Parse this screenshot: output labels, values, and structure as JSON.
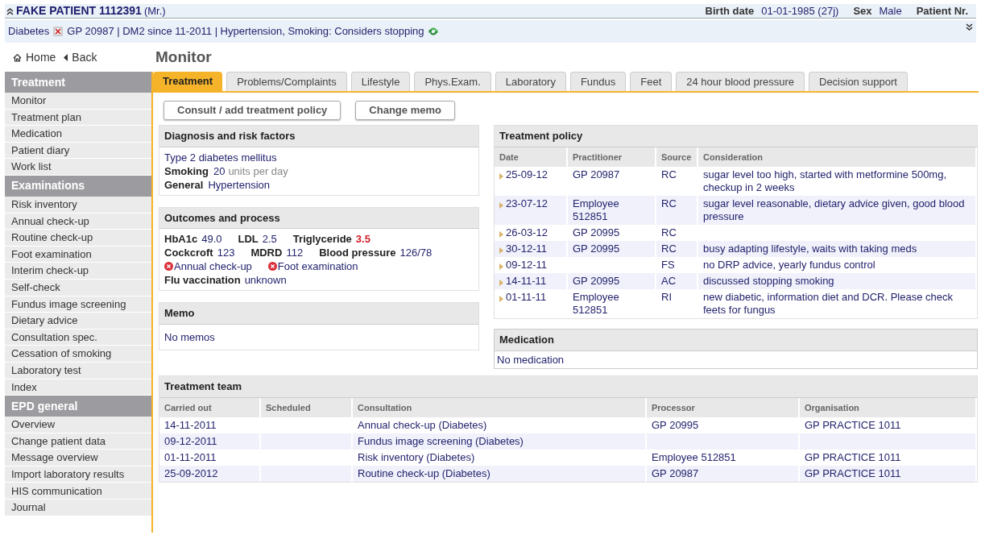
{
  "patient": {
    "name": "FAKE PATIENT 1112391",
    "title": "(Mr.)",
    "fields": [
      {
        "label": "Birth date",
        "value": "01-01-1985 (27j)"
      },
      {
        "label": "Sex",
        "value": "Male"
      },
      {
        "label": "Patient Nr."
      }
    ]
  },
  "problem_line": {
    "condition": "Diabetes",
    "summary": "GP 20987 | DM2 since 11-2011 | Hypertension, Smoking: Considers stopping"
  },
  "nav": {
    "home": "Home",
    "back": "Back"
  },
  "page_title": "Monitor",
  "sidebar": [
    {
      "title": "Treatment",
      "items": [
        "Monitor",
        "Treatment plan",
        "Medication",
        "Patient diary",
        "Work list"
      ]
    },
    {
      "title": "Examinations",
      "items": [
        "Risk inventory",
        "Annual check-up",
        "Routine check-up",
        "Foot examination",
        "Interim check-up",
        "Self-check",
        "Fundus image screening",
        "Dietary advice",
        "Consultation spec.",
        "Cessation of smoking",
        "Laboratory test",
        "Index"
      ]
    },
    {
      "title": "EPD general",
      "items": [
        "Overview",
        "Change patient data",
        "Message overview",
        "Import laboratory results",
        "HIS communication",
        "Journal"
      ]
    }
  ],
  "tabs": [
    {
      "label": "Treatment",
      "selected": true
    },
    {
      "label": "Problems/Complaints",
      "selected": false
    },
    {
      "label": "Lifestyle",
      "selected": false
    },
    {
      "label": "Phys.Exam.",
      "selected": false
    },
    {
      "label": "Laboratory",
      "selected": false
    },
    {
      "label": "Fundus",
      "selected": false
    },
    {
      "label": "Feet",
      "selected": false
    },
    {
      "label": "24 hour blood pressure",
      "selected": false
    },
    {
      "label": "Decision support",
      "selected": false
    }
  ],
  "buttons": [
    "Consult / add treatment policy",
    "Change memo"
  ],
  "diagnosis": {
    "title": "Diagnosis and risk factors",
    "rows": [
      {
        "value": "Type 2 diabetes mellitus"
      },
      {
        "label": "Smoking",
        "value": "20",
        "unit": "units per day"
      },
      {
        "label": "General",
        "value": "Hypertension"
      }
    ]
  },
  "outcomes": {
    "title": "Outcomes and process",
    "rows": [
      [
        {
          "kind": "measure",
          "label": "HbA1c",
          "value": "49.0",
          "abnormal": false
        },
        {
          "kind": "measure",
          "label": "LDL",
          "value": "2.5",
          "abnormal": false
        },
        {
          "kind": "measure",
          "label": "Triglyceride",
          "value": "3.5",
          "abnormal": true
        }
      ],
      [
        {
          "kind": "measure",
          "label": "Cockcroft",
          "value": "123",
          "abnormal": false
        },
        {
          "kind": "measure",
          "label": "MDRD",
          "value": "112",
          "abnormal": false
        },
        {
          "kind": "measure",
          "label": "Blood pressure",
          "value": "126/78",
          "abnormal": false
        }
      ],
      [
        {
          "kind": "alert",
          "text": "Annual check-up"
        },
        {
          "kind": "alert",
          "text": "Foot examination"
        }
      ],
      [
        {
          "kind": "measure",
          "label": "Flu vaccination",
          "value": "unknown",
          "abnormal": false
        }
      ]
    ]
  },
  "memo": {
    "title": "Memo",
    "text": "No memos"
  },
  "treatment_policy": {
    "title": "Treatment policy",
    "columns": [
      "Date",
      "Practitioner",
      "Source",
      "Consideration"
    ],
    "rows": [
      [
        "25-09-12",
        "GP 20987",
        "RC",
        "sugar level too high, started with metformine 500mg, checkup in 2 weeks"
      ],
      [
        "23-07-12",
        "Employee 512851",
        "RC",
        "sugar level reasonable, dietary advice given, good blood pressure"
      ],
      [
        "26-03-12",
        "GP 20995",
        "RC",
        ""
      ],
      [
        "30-12-11",
        "GP 20995",
        "RC",
        "busy adapting lifestyle, waits with taking meds"
      ],
      [
        "09-12-11",
        "",
        "FS",
        "no DRP advice, yearly fundus control"
      ],
      [
        "14-11-11",
        "GP 20995",
        "AC",
        "discussed stopping smoking"
      ],
      [
        "01-11-11",
        "Employee 512851",
        "RI",
        "new diabetic, information diet and DCR. Please check feets for fungus"
      ]
    ]
  },
  "medication": {
    "title": "Medication",
    "text": "No medication"
  },
  "treatment_team": {
    "title": "Treatment team",
    "columns": [
      "Carried out",
      "Scheduled",
      "Consultation",
      "Processor",
      "Organisation"
    ],
    "rows": [
      [
        "14-11-2011",
        "",
        "Annual check-up (Diabetes)",
        "GP 20995",
        "GP PRACTICE 1011"
      ],
      [
        "09-12-2011",
        "",
        "Fundus image screening (Diabetes)",
        "",
        ""
      ],
      [
        "01-11-2011",
        "",
        "Risk inventory (Diabetes)",
        "Employee 512851",
        "GP PRACTICE 1011"
      ],
      [
        "25-09-2012",
        "",
        "Routine check-up (Diabetes)",
        "GP 20987",
        "GP PRACTICE 1011"
      ]
    ]
  }
}
